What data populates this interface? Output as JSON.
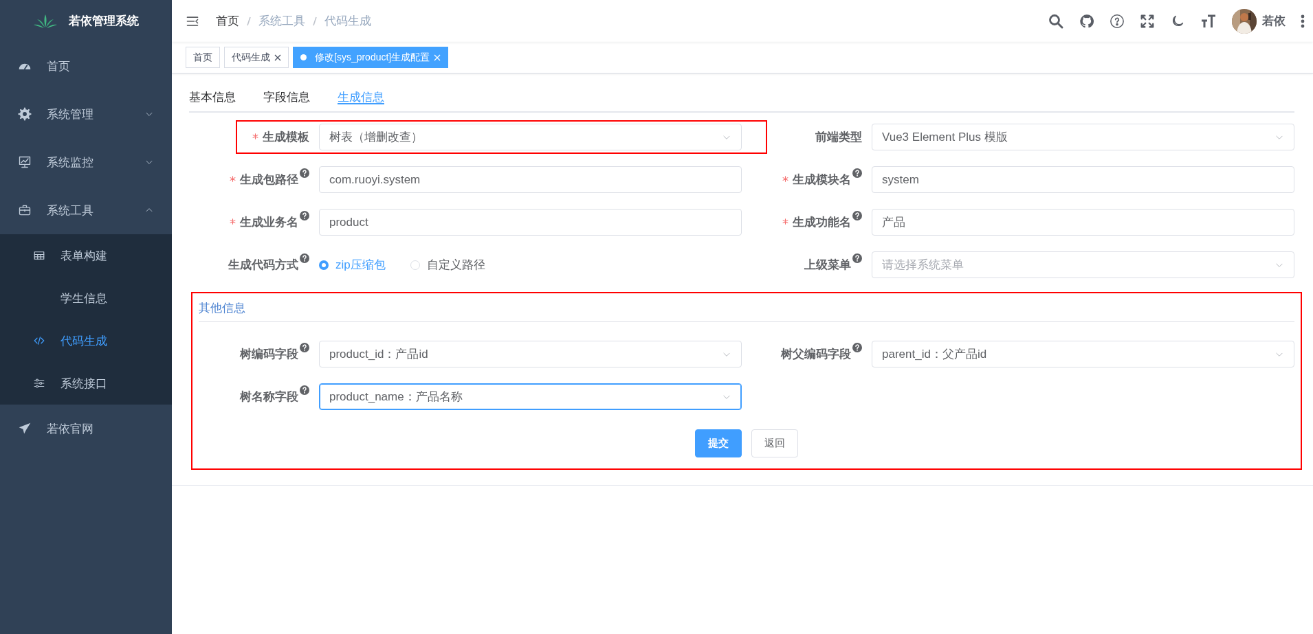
{
  "sidebar": {
    "title": "若依管理系统",
    "items": [
      {
        "label": "首页",
        "kind": "link",
        "selected": false
      },
      {
        "label": "系统管理",
        "kind": "group",
        "selected": false,
        "expanded": false
      },
      {
        "label": "系统监控",
        "kind": "group",
        "selected": false,
        "expanded": false
      },
      {
        "label": "系统工具",
        "kind": "group",
        "selected": false,
        "expanded": true,
        "children": [
          {
            "label": "表单构建",
            "selected": false
          },
          {
            "label": "学生信息",
            "selected": false
          },
          {
            "label": "代码生成",
            "selected": true
          },
          {
            "label": "系统接口",
            "selected": false
          }
        ]
      },
      {
        "label": "若依官网",
        "kind": "link",
        "selected": false
      }
    ]
  },
  "navbar": {
    "breadcrumb": [
      "首页",
      "系统工具",
      "代码生成"
    ],
    "user": "若依"
  },
  "tags": [
    {
      "label": "首页",
      "closable": false,
      "selected": false
    },
    {
      "label": "代码生成",
      "closable": true,
      "selected": false
    },
    {
      "label": "修改[sys_product]生成配置",
      "closable": true,
      "selected": true
    }
  ],
  "tabs": [
    {
      "label": "基本信息",
      "selected": false
    },
    {
      "label": "字段信息",
      "selected": false
    },
    {
      "label": "生成信息",
      "selected": true
    }
  ],
  "fields": [
    {
      "label": "生成模板",
      "kind": "select",
      "value": "树表（增删改查）",
      "required": true,
      "help": false,
      "highlighted": true
    },
    {
      "label": "前端类型",
      "kind": "select",
      "value": "Vue3 Element Plus 模版",
      "required": false,
      "help": false,
      "highlighted": false
    },
    {
      "label": "生成包路径",
      "kind": "input",
      "value": "com.ruoyi.system",
      "required": true,
      "help": true,
      "highlighted": false
    },
    {
      "label": "生成模块名",
      "kind": "input",
      "value": "system",
      "required": true,
      "help": true,
      "highlighted": false
    },
    {
      "label": "生成业务名",
      "kind": "input",
      "value": "product",
      "required": true,
      "help": true,
      "highlighted": false
    },
    {
      "label": "生成功能名",
      "kind": "input",
      "value": "产品",
      "required": true,
      "help": true,
      "highlighted": false
    },
    {
      "label": "生成代码方式",
      "kind": "radio",
      "options": [
        {
          "label": "zip压缩包",
          "selected": true
        },
        {
          "label": "自定义路径",
          "selected": false
        }
      ],
      "required": false,
      "help": true,
      "highlighted": false
    },
    {
      "label": "上级菜单",
      "kind": "select",
      "placeholder": "请选择系统菜单",
      "required": false,
      "help": true,
      "highlighted": false
    }
  ],
  "other": {
    "title": "其他信息",
    "highlighted": true,
    "fields": [
      {
        "label": "树编码字段",
        "kind": "select",
        "value": "product_id：产品id",
        "required": false,
        "help": true,
        "focused": false,
        "highlighted": false
      },
      {
        "label": "树父编码字段",
        "kind": "select",
        "value": "parent_id：父产品id",
        "required": false,
        "help": true,
        "focused": false,
        "highlighted": false
      },
      {
        "label": "树名称字段",
        "kind": "select",
        "value": "product_name：产品名称",
        "required": false,
        "help": true,
        "focused": true,
        "highlighted": false
      }
    ],
    "buttons": [
      {
        "label": "提交",
        "kind": "primary"
      },
      {
        "label": "返回",
        "kind": "default"
      }
    ]
  }
}
